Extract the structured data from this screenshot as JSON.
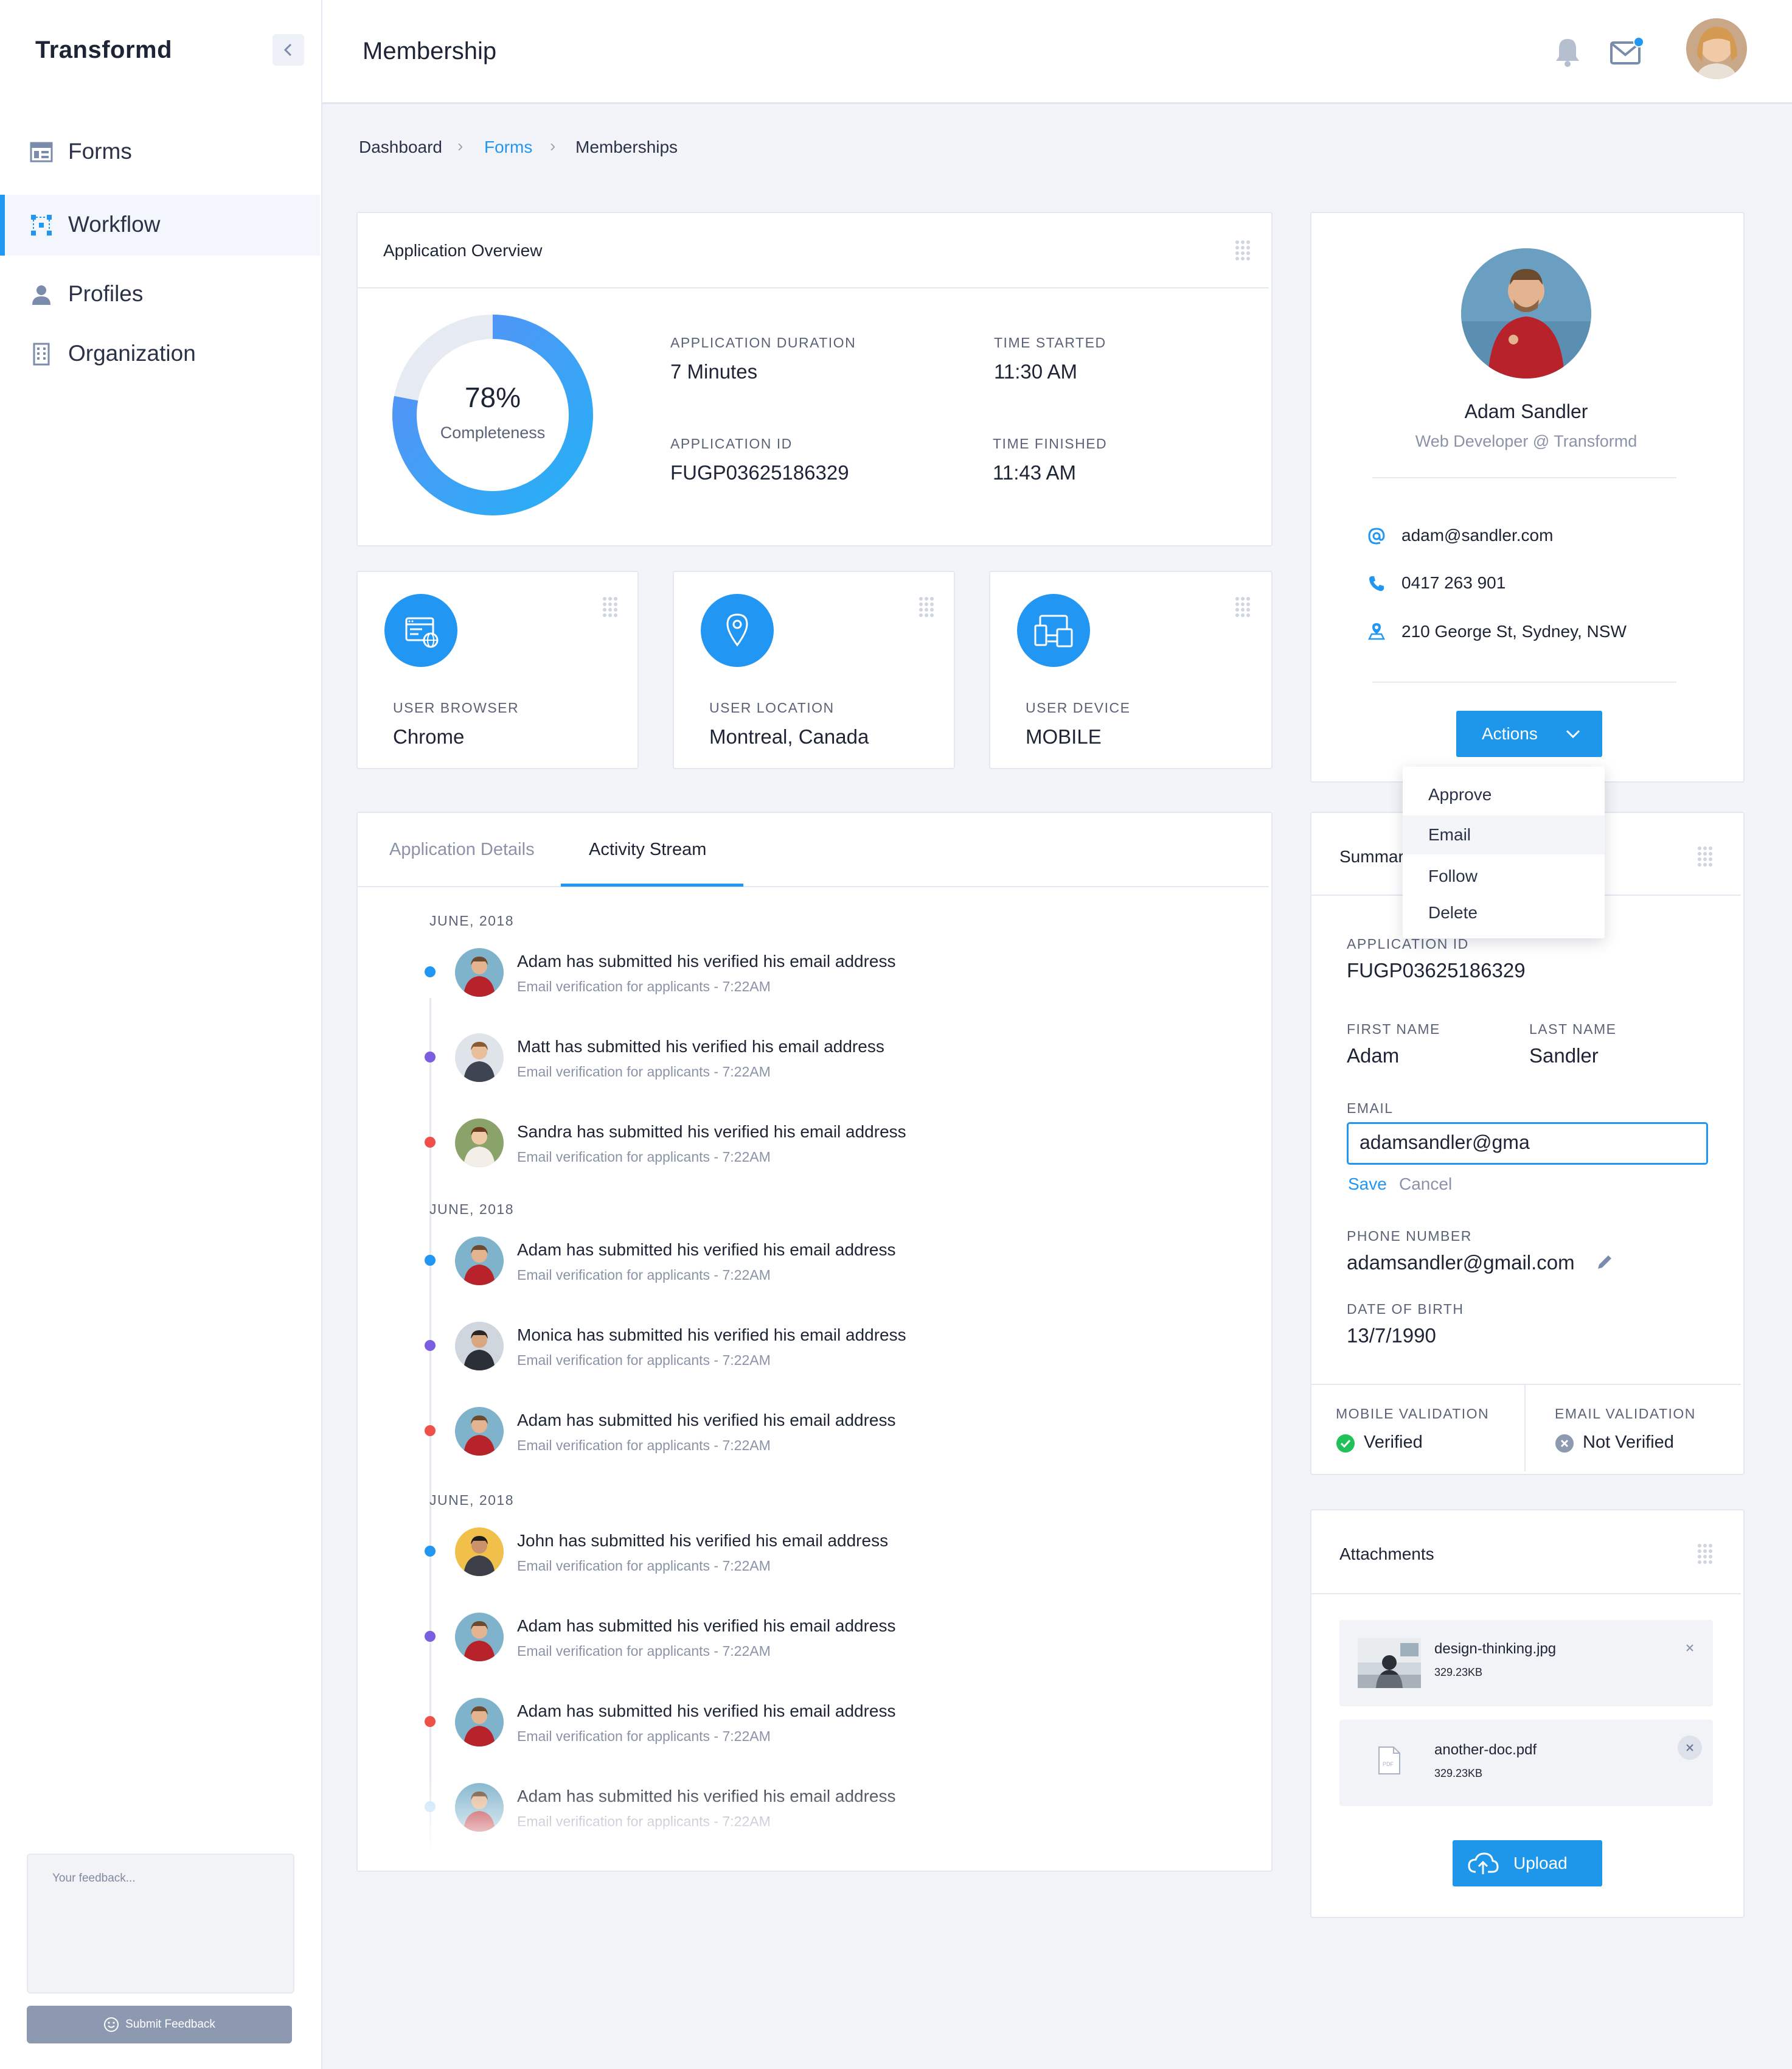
{
  "app": {
    "brand": "Transformd",
    "page_title": "Membership",
    "collapse_icon": "chevron-left-icon"
  },
  "colors": {
    "accent": "#2196f3",
    "success": "#21c15a",
    "danger": "#f0504a",
    "purple": "#7c5fe0"
  },
  "sidebar": {
    "items": [
      {
        "label": "Forms",
        "icon": "forms-icon"
      },
      {
        "label": "Workflow",
        "icon": "workflow-icon",
        "active": true
      },
      {
        "label": "Profiles",
        "icon": "user-icon"
      },
      {
        "label": "Organization",
        "icon": "building-icon"
      }
    ],
    "feedback_placeholder": "Your feedback...",
    "feedback_button": "Submit Feedback"
  },
  "breadcrumb": [
    "Dashboard",
    "Forms",
    "Memberships"
  ],
  "overview": {
    "title": "Application Overview",
    "percent_label": "78%",
    "percent": 78,
    "completeness_label": "Completeness",
    "duration_label": "APPLICATION DURATION",
    "duration": "7 Minutes",
    "started_label": "TIME STARTED",
    "started": "11:30 AM",
    "id_label": "APPLICATION ID",
    "id": "FUGP03625186329",
    "finished_label": "TIME FINISHED",
    "finished": "11:43 AM"
  },
  "stats": [
    {
      "label": "USER BROWSER",
      "value": "Chrome",
      "icon": "browser-icon"
    },
    {
      "label": "USER LOCATION",
      "value": "Montreal, Canada",
      "icon": "location-pin-icon"
    },
    {
      "label": "USER DEVICE",
      "value": "MOBILE",
      "icon": "devices-icon"
    }
  ],
  "tabs": [
    "Application Details",
    "Activity Stream"
  ],
  "activity": {
    "groups": [
      {
        "month": "JUNE, 2018",
        "items": [
          {
            "title": "Adam has submitted his verified his email address",
            "sub": "Email verification for applicants - 7:22AM"
          },
          {
            "title": "Matt has submitted his verified his email address",
            "sub": "Email verification for applicants - 7:22AM"
          },
          {
            "title": "Sandra has submitted his verified his email address",
            "sub": "Email verification for applicants - 7:22AM"
          }
        ]
      },
      {
        "month": "JUNE, 2018",
        "items": [
          {
            "title": "Adam has submitted his verified his email address",
            "sub": "Email verification for applicants - 7:22AM"
          },
          {
            "title": "Monica has submitted his verified his email address",
            "sub": "Email verification for applicants - 7:22AM"
          },
          {
            "title": "Adam has submitted his verified his email address",
            "sub": "Email verification for applicants - 7:22AM"
          }
        ]
      },
      {
        "month": "JUNE, 2018",
        "items": [
          {
            "title": "John has submitted his verified his email address",
            "sub": "Email verification for applicants - 7:22AM"
          },
          {
            "title": "Adam has submitted his verified his email address",
            "sub": "Email verification for applicants - 7:22AM"
          },
          {
            "title": "Adam has submitted his verified his email address",
            "sub": "Email verification for applicants - 7:22AM"
          },
          {
            "title": "Adam has submitted his verified his email address",
            "sub": "Email verification for applicants - 7:22AM"
          }
        ]
      }
    ]
  },
  "profile": {
    "name": "Adam Sandler",
    "role": "Web Developer @ Transformd",
    "email": "adam@sandler.com",
    "phone": "0417 263 901",
    "address": "210 George St, Sydney, NSW",
    "actions_label": "Actions",
    "actions_menu": [
      "Approve",
      "Email",
      "Follow",
      "Delete"
    ]
  },
  "summary": {
    "title": "Summar",
    "app_id_label": "APPLICATION ID",
    "app_id": "FUGP03625186329",
    "first_name_label": "FIRST NAME",
    "first_name": "Adam",
    "last_name_label": "LAST NAME",
    "last_name": "Sandler",
    "email_label": "EMAIL",
    "email_value": "adamsandler@gma",
    "save_label": "Save",
    "cancel_label": "Cancel",
    "phone_label": "PHONE NUMBER",
    "phone_value": "adamsandler@gmail.com",
    "dob_label": "DATE OF BIRTH",
    "dob": "13/7/1990",
    "mobile_validation_label": "MOBILE VALIDATION",
    "mobile_validation": "Verified",
    "email_validation_label": "EMAIL VALIDATION",
    "email_validation": "Not Verified"
  },
  "attachments": {
    "title": "Attachments",
    "files": [
      {
        "name": "design-thinking.jpg",
        "size": "329.23KB"
      },
      {
        "name": "another-doc.pdf",
        "size": "329.23KB"
      }
    ],
    "upload_label": "Upload"
  }
}
